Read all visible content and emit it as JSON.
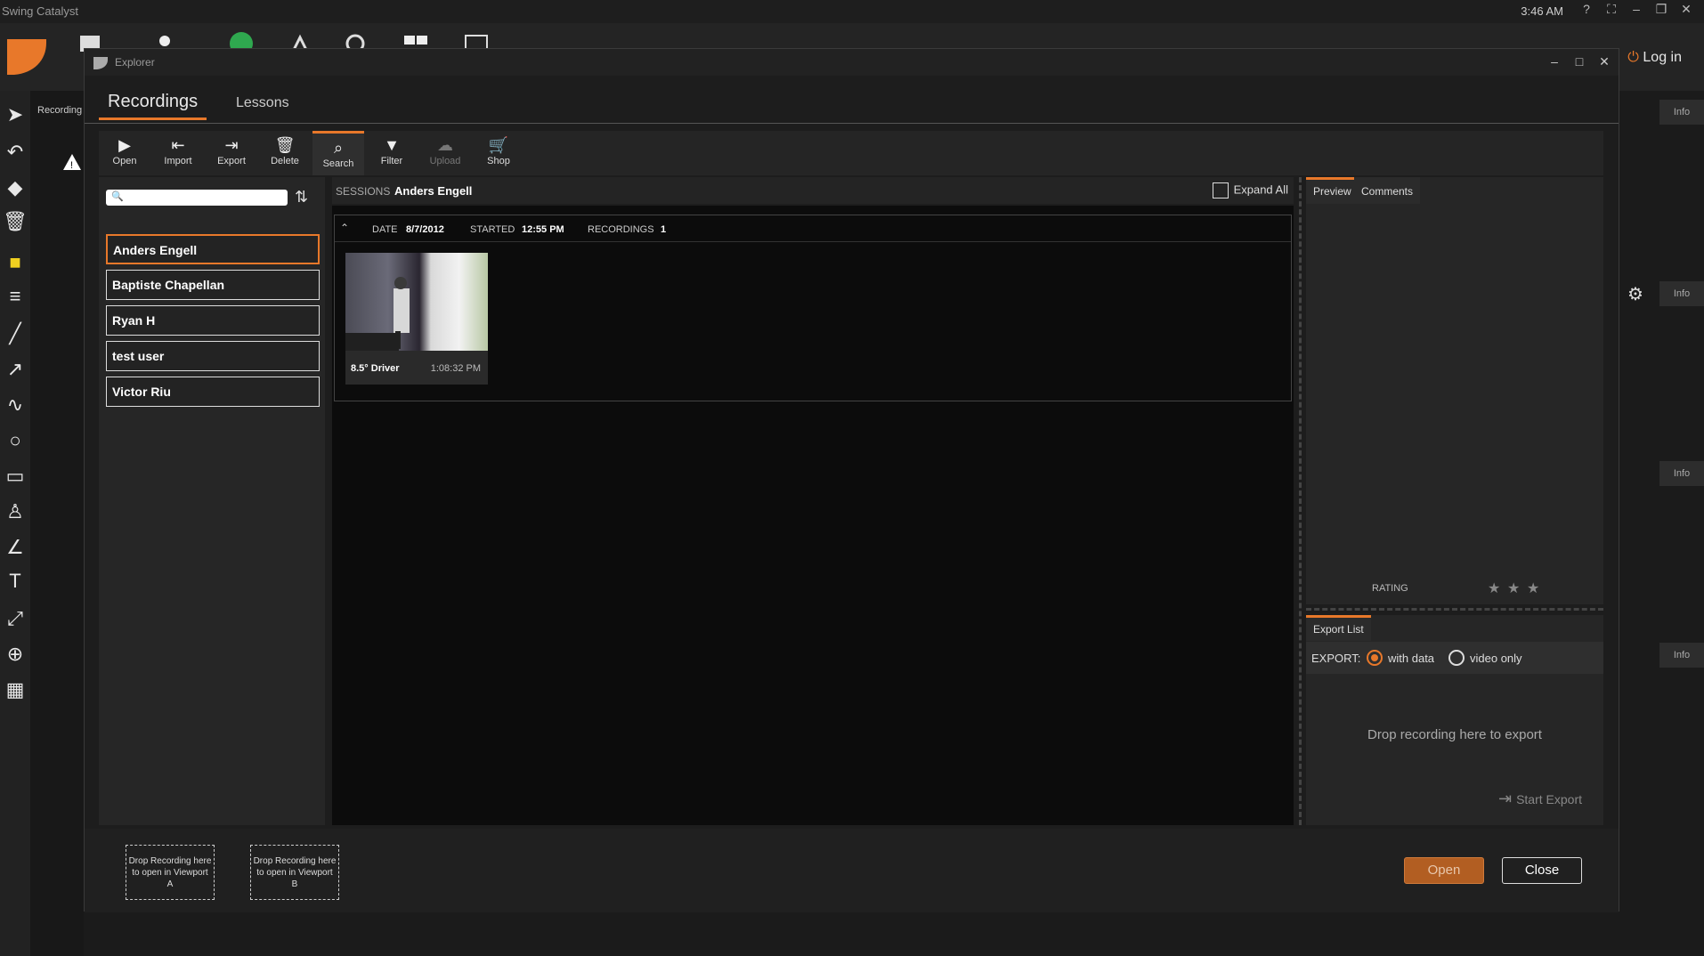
{
  "app": {
    "title": "Swing Catalyst",
    "time": "3:46 AM",
    "login": "Log in",
    "bg_recording": "Recording",
    "info": "Info"
  },
  "explorer": {
    "title": "Explorer",
    "tabs": [
      {
        "label": "Recordings"
      },
      {
        "label": "Lessons"
      }
    ],
    "toolbar": [
      {
        "label": "Open",
        "icon": "play-icon"
      },
      {
        "label": "Import",
        "icon": "import-icon"
      },
      {
        "label": "Export",
        "icon": "export-icon"
      },
      {
        "label": "Delete",
        "icon": "trash-icon"
      },
      {
        "label": "Search",
        "icon": "search-icon"
      },
      {
        "label": "Filter",
        "icon": "filter-icon"
      },
      {
        "label": "Upload",
        "icon": "upload-cloud-icon"
      },
      {
        "label": "Shop",
        "icon": "cart-icon"
      }
    ],
    "people": [
      "Anders Engell",
      "Baptiste Chapellan",
      "Ryan H",
      "test user",
      "Victor Riu"
    ],
    "sessions": {
      "label": "SESSIONS",
      "selected": "Anders Engell",
      "expand_all": "Expand All",
      "date_label": "DATE",
      "date": "8/7/2012",
      "started_label": "STARTED",
      "started": "12:55 PM",
      "recordings_label": "RECORDINGS",
      "recordings": "1"
    },
    "recording": {
      "name": "8.5° Driver",
      "time": "1:08:32 PM"
    },
    "preview_tabs": [
      "Preview",
      "Comments"
    ],
    "rating_label": "RATING",
    "rating": {
      "value": 0,
      "max": 3
    },
    "export": {
      "tab": "Export List",
      "label": "EXPORT:",
      "with_data": "with data",
      "video_only": "video only",
      "drop": "Drop recording here to export",
      "start": "Start Export"
    },
    "dropzones": [
      "Drop Recording here to open in Viewport A",
      "Drop Recording here to open in Viewport B"
    ],
    "open_button": "Open",
    "close_button": "Close"
  },
  "colors": {
    "accent": "#e8782a"
  }
}
